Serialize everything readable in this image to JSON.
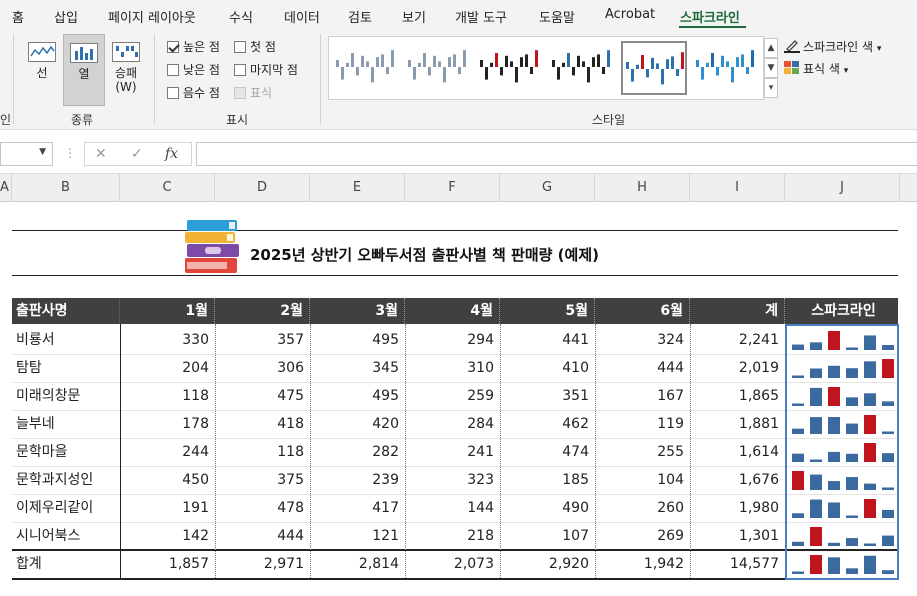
{
  "menu": {
    "items": [
      "홈",
      "삽입",
      "페이지 레이아웃",
      "수식",
      "데이터",
      "검토",
      "보기",
      "개발 도구",
      "도움말",
      "Acrobat",
      "스파크라인"
    ],
    "active_index": 10
  },
  "ribbon": {
    "type_group": {
      "label": "종류",
      "left_fragment": "인",
      "buttons": [
        {
          "label": "선",
          "icon": "sparkline-line-icon"
        },
        {
          "label": "열",
          "icon": "sparkline-column-icon",
          "selected": true
        },
        {
          "label": "승패\n(W)",
          "icon": "sparkline-winloss-icon"
        }
      ]
    },
    "show_group": {
      "label": "표시",
      "checkboxes": [
        {
          "label": "높은 점",
          "checked": true,
          "enabled": true
        },
        {
          "label": "첫 점",
          "checked": false,
          "enabled": true
        },
        {
          "label": "낮은 점",
          "checked": false,
          "enabled": true
        },
        {
          "label": "마지막 점",
          "checked": false,
          "enabled": true
        },
        {
          "label": "음수 점",
          "checked": false,
          "enabled": true
        },
        {
          "label": "표식",
          "checked": false,
          "enabled": false
        }
      ]
    },
    "style_group": {
      "label": "스타일",
      "selected_index": 4,
      "thumb_colors": [
        [
          "#8a9bb0",
          "#8a9bb0"
        ],
        [
          "#8a9bb0",
          "#8a9bb0"
        ],
        [
          "#222222",
          "#c0141e"
        ],
        [
          "#222222",
          "#2d6fb0"
        ],
        [
          "#2d6fb0",
          "#c0141e"
        ],
        [
          "#2d8fd0",
          "#1f6bb0"
        ]
      ]
    },
    "color_buttons": {
      "sparkline_color": "스파크라인 색",
      "marker_color": "표식 색"
    }
  },
  "formula_bar": {
    "name_box": "",
    "cancel": "✕",
    "enter": "✓",
    "fx": "fx",
    "value": ""
  },
  "columns": [
    "A",
    "B",
    "C",
    "D",
    "E",
    "F",
    "G",
    "H",
    "I",
    "J"
  ],
  "sheet": {
    "title": "2025년 상반기 오빠두서점 출판사별 책 판매량 (예제)",
    "headers": [
      "출판사명",
      "1월",
      "2월",
      "3월",
      "4월",
      "5월",
      "6월",
      "계",
      "스파크라인"
    ],
    "rows": [
      {
        "name": "비룡서",
        "months": [
          "330",
          "357",
          "495",
          "294",
          "441",
          "324"
        ],
        "total": "2,241"
      },
      {
        "name": "탐탐",
        "months": [
          "204",
          "306",
          "345",
          "310",
          "410",
          "444"
        ],
        "total": "2,019"
      },
      {
        "name": "미래의창문",
        "months": [
          "118",
          "475",
          "495",
          "259",
          "351",
          "167"
        ],
        "total": "1,865"
      },
      {
        "name": "늘부네",
        "months": [
          "178",
          "418",
          "420",
          "284",
          "462",
          "119"
        ],
        "total": "1,881"
      },
      {
        "name": "문학마을",
        "months": [
          "244",
          "118",
          "282",
          "241",
          "474",
          "255"
        ],
        "total": "1,614"
      },
      {
        "name": "문학과지성인",
        "months": [
          "450",
          "375",
          "239",
          "323",
          "185",
          "104"
        ],
        "total": "1,676"
      },
      {
        "name": "이제우리같이",
        "months": [
          "191",
          "478",
          "417",
          "144",
          "490",
          "260"
        ],
        "total": "1,980"
      },
      {
        "name": "시니어북스",
        "months": [
          "142",
          "444",
          "121",
          "218",
          "107",
          "269"
        ],
        "total": "1,301"
      }
    ],
    "total_row": {
      "name": "합계",
      "months": [
        "1,857",
        "2,971",
        "2,814",
        "2,073",
        "2,920",
        "1,942"
      ],
      "total": "14,577"
    }
  },
  "colors": {
    "header_bg": "#404040",
    "spark_bar": "#3b6aa0",
    "spark_high": "#c0141e",
    "selection": "#4a7fc1",
    "active_tab": "#1d6b3a"
  }
}
